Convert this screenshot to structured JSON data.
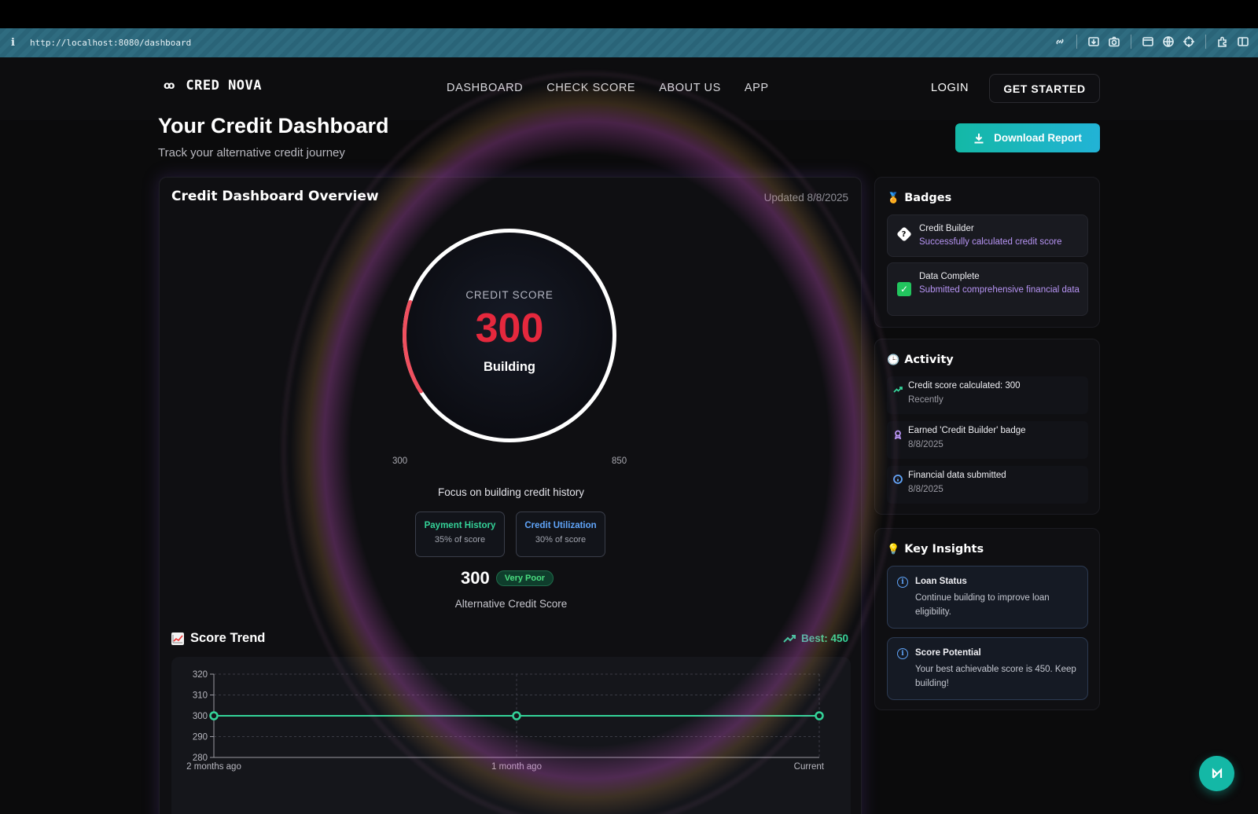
{
  "browser": {
    "url": "http://localhost:8080/dashboard",
    "toolbar_icons": [
      "link-icon",
      "download-icon",
      "camera-icon",
      "terminal-icon",
      "globe-icon",
      "crosshair-icon",
      "extensions-icon",
      "sidebar-icon"
    ]
  },
  "nav": {
    "logo_text": "CRED NOVA",
    "links": [
      "DASHBOARD",
      "CHECK SCORE",
      "ABOUT US",
      "APP"
    ],
    "login_label": "LOGIN",
    "get_started_label": "GET STARTED"
  },
  "header": {
    "title": "Your Credit Dashboard",
    "subtitle": "Track your alternative credit journey",
    "download_label": "Download Report"
  },
  "overview": {
    "title": "Credit Dashboard Overview",
    "updated": "Updated 8/8/2025",
    "gauge": {
      "label": "CREDIT SCORE",
      "value": "300",
      "status": "Building",
      "min": "300",
      "max": "850",
      "fill_fraction": 0.14
    },
    "focus_text": "Focus on building credit history",
    "factors": [
      {
        "name": "Payment History",
        "value": "35% of score"
      },
      {
        "name": "Credit Utilization",
        "value": "30% of score"
      }
    ],
    "score": "300",
    "score_rating": "Very Poor",
    "score_caption": "Alternative Credit Score",
    "trend": {
      "title": "Score Trend",
      "best": "Best: 450"
    }
  },
  "chart_data": {
    "type": "line",
    "categories": [
      "2 months ago",
      "1 month ago",
      "Current"
    ],
    "values": [
      300,
      300,
      300
    ],
    "ylim": [
      280,
      320
    ],
    "yticks": [
      280,
      290,
      300,
      310,
      320
    ],
    "grid": true,
    "color": "#34d399"
  },
  "badges": {
    "title": "Badges",
    "items": [
      {
        "name": "Credit Builder",
        "desc": "Successfully calculated credit score"
      },
      {
        "name": "Data Complete",
        "desc": "Submitted comprehensive financial data"
      }
    ]
  },
  "activity": {
    "title": "Activity",
    "items": [
      {
        "text": "Credit score calculated: 300",
        "date": "Recently"
      },
      {
        "text": "Earned 'Credit Builder' badge",
        "date": "8/8/2025"
      },
      {
        "text": "Financial data submitted",
        "date": "8/8/2025"
      }
    ]
  },
  "insights": {
    "title": "Key Insights",
    "items": [
      {
        "name": "Loan Status",
        "desc": "Continue building to improve loan eligibility."
      },
      {
        "name": "Score Potential",
        "desc": "Your best achievable score is 450. Keep building!"
      }
    ]
  },
  "colors": {
    "accent": "#14b8a6",
    "score_red": "#e5283d",
    "positive": "#34d399",
    "info": "#60a5fa",
    "badge_text": "#b794f4"
  }
}
